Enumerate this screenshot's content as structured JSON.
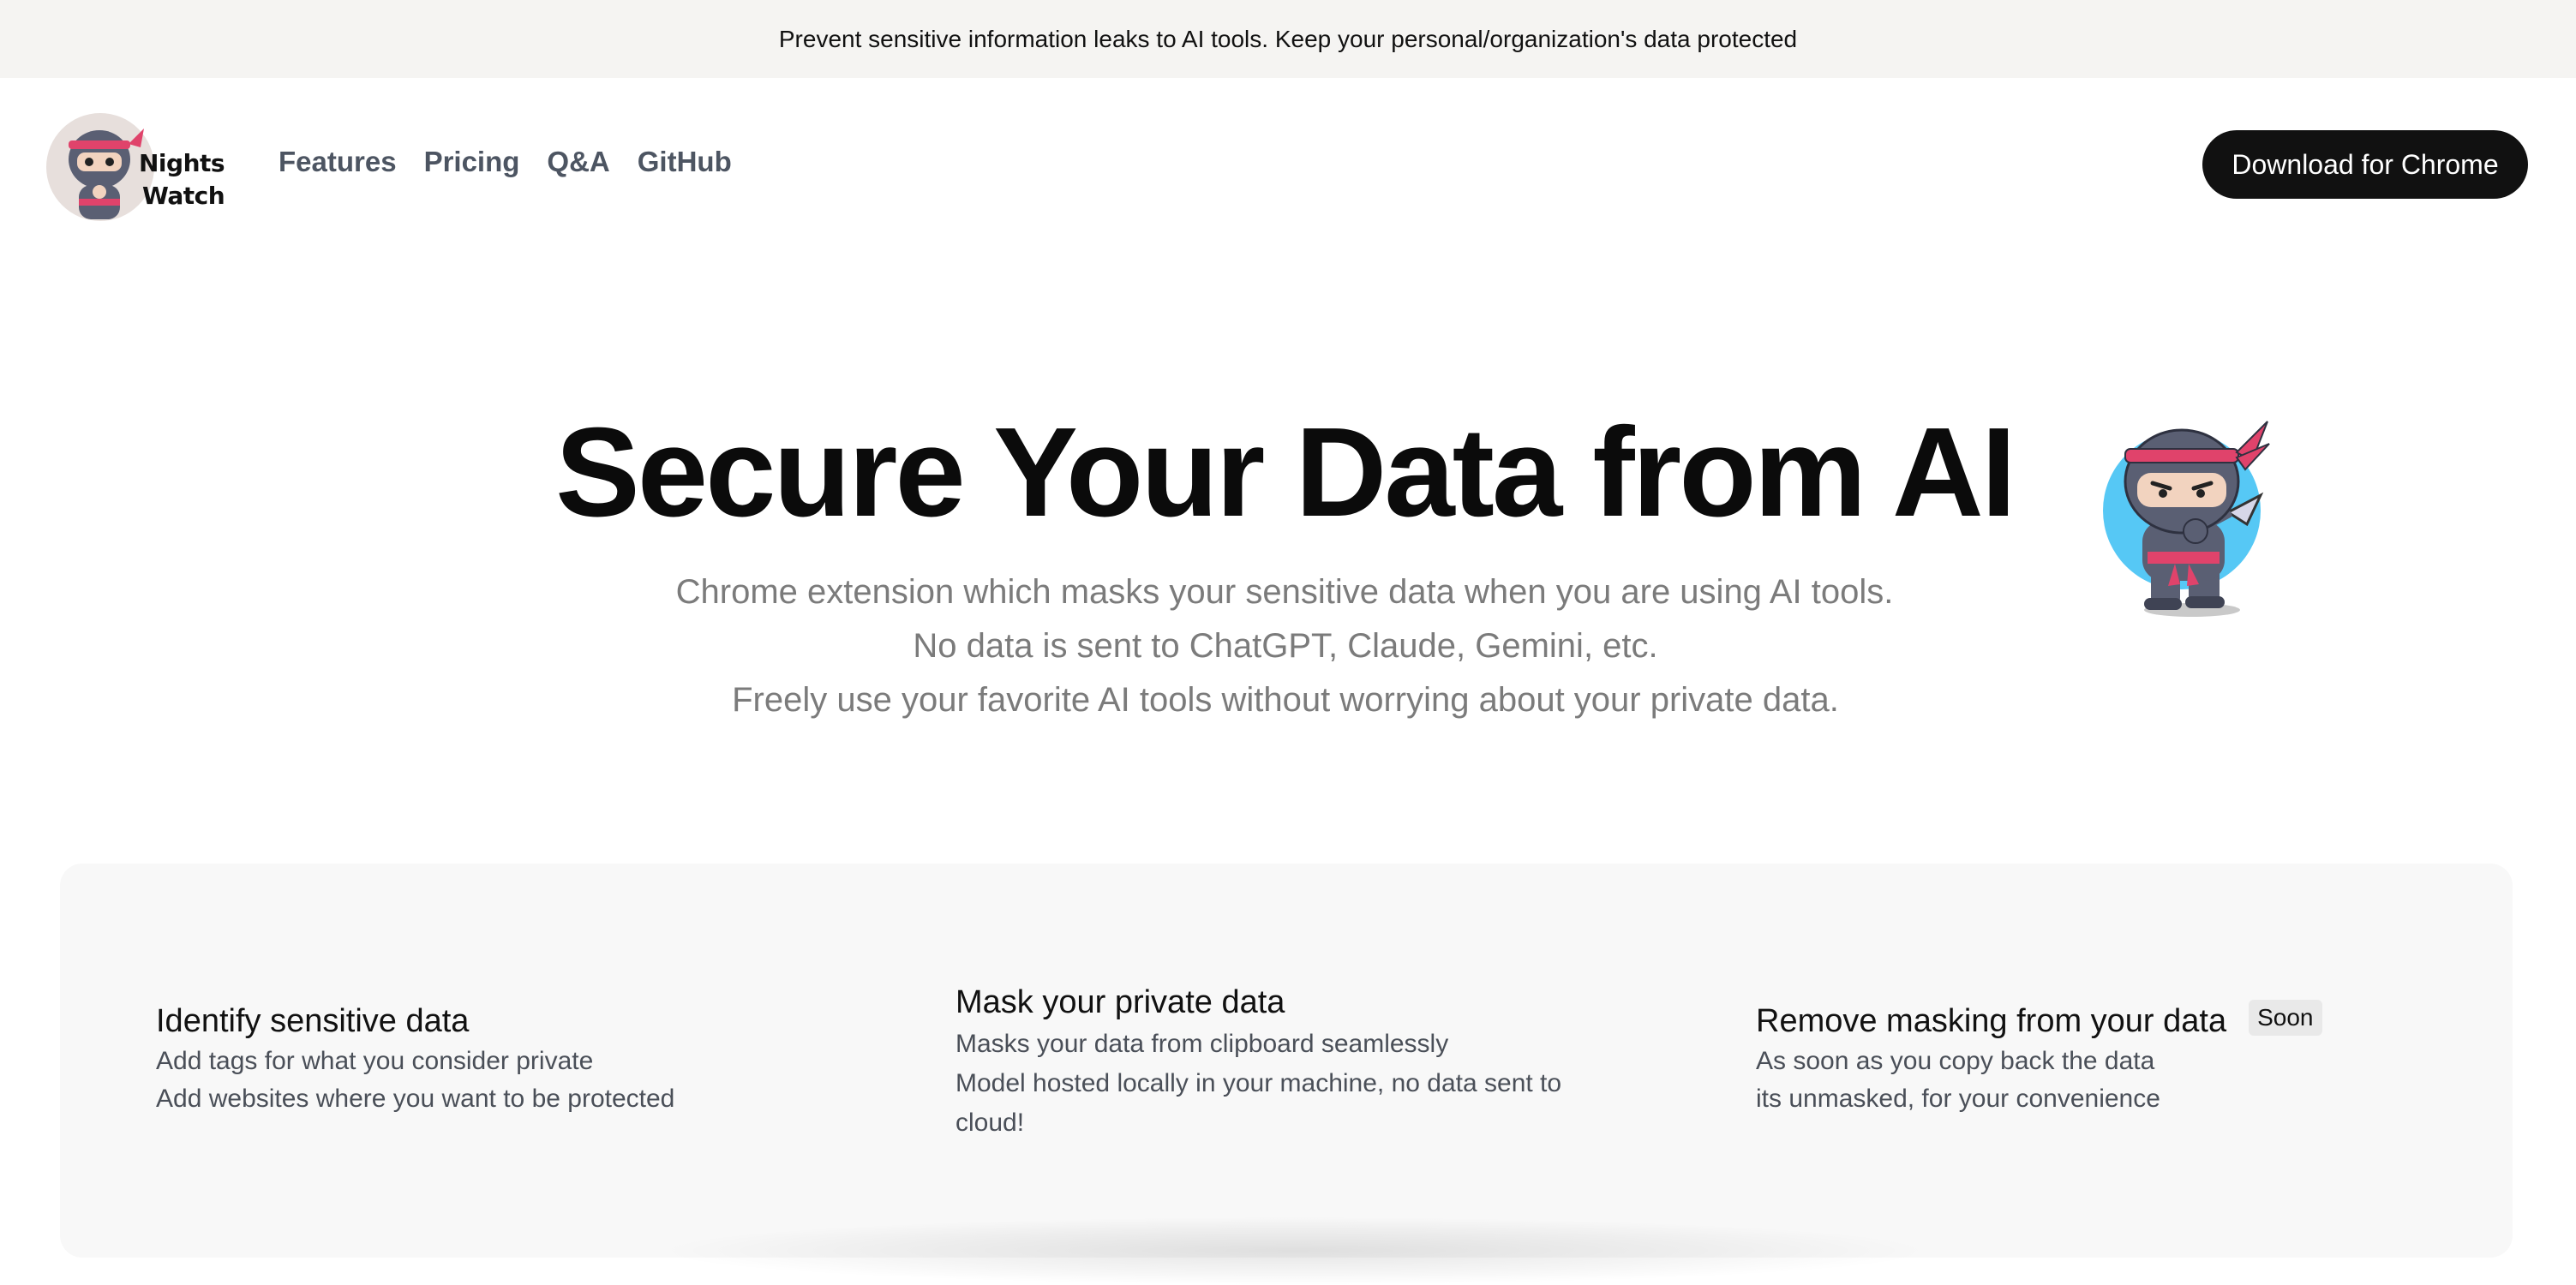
{
  "announcement": "Prevent sensitive information leaks to AI tools. Keep your personal/organization's data protected",
  "brand": {
    "line1": "Nights",
    "line2": "Watch",
    "logo_icon": "ninja-icon"
  },
  "nav": {
    "features": "Features",
    "pricing": "Pricing",
    "qa": "Q&A",
    "github": "GitHub"
  },
  "cta": {
    "download": "Download for Chrome"
  },
  "hero": {
    "title": "Secure Your Data from AI",
    "subtitle_lines": [
      "Chrome extension which masks your sensitive data when you are using AI tools.",
      "No data is sent to ChatGPT, Claude, Gemini, etc.",
      "Freely use your favorite AI tools without worrying about your private data."
    ],
    "illustration_icon": "ninja-icon"
  },
  "features": [
    {
      "title": "Identify sensitive data",
      "lines": [
        "Add tags for what you consider private",
        "Add websites where you want to be protected"
      ]
    },
    {
      "title": "Mask your private data",
      "lines": [
        "Masks your data from clipboard seamlessly",
        "Model hosted locally in your machine, no data sent to cloud!"
      ]
    },
    {
      "title": "Remove masking from your data",
      "badge": "Soon",
      "lines": [
        "As soon as you copy back the data",
        "its unmasked, for your convenience"
      ]
    }
  ],
  "colors": {
    "announcement_bg": "#f5f4f2",
    "cta_bg": "#111111",
    "nav_text": "#4d5562",
    "subtitle_text": "#7b7b7b",
    "panel_bg": "#f8f8f8",
    "ninja_circle": "#56c8f5",
    "ninja_headband": "#e0436b"
  }
}
